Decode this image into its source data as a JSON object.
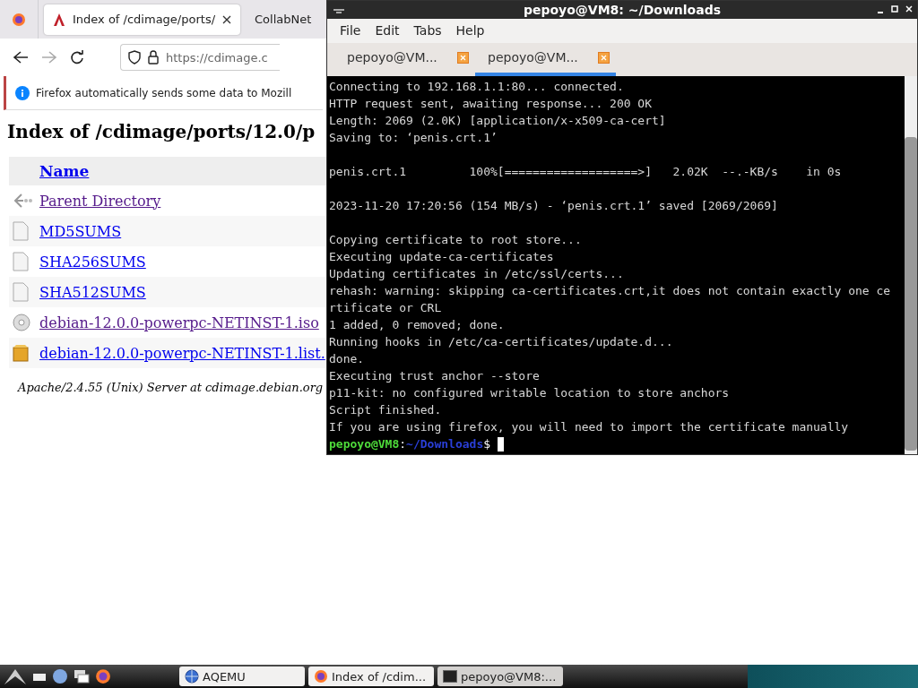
{
  "browser": {
    "tabs": [
      {
        "title": "Index of /cdimage/ports/",
        "selected": true
      },
      {
        "title": "CollabNet",
        "selected": false
      }
    ],
    "url": "https://cdimage.c",
    "notification": "Firefox automatically sends some data to Mozill",
    "heading": "Index of /cdimage/ports/12.0/p",
    "listing": {
      "header": "Name",
      "rows": [
        {
          "kind": "parent",
          "name": "Parent Directory",
          "visited": true
        },
        {
          "kind": "file",
          "name": "MD5SUMS",
          "visited": false
        },
        {
          "kind": "file",
          "name": "SHA256SUMS",
          "visited": false
        },
        {
          "kind": "file",
          "name": "SHA512SUMS",
          "visited": false
        },
        {
          "kind": "disc",
          "name": "debian-12.0.0-powerpc-NETINST-1.iso",
          "visited": true
        },
        {
          "kind": "package",
          "name": "debian-12.0.0-powerpc-NETINST-1.list.",
          "visited": false
        }
      ]
    },
    "footer": "Apache/2.4.55 (Unix) Server at cdimage.debian.org"
  },
  "terminal": {
    "title": "pepoyo@VM8: ~/Downloads",
    "menu": [
      "File",
      "Edit",
      "Tabs",
      "Help"
    ],
    "tabs": [
      {
        "label": "pepoyo@VM...",
        "selected": false
      },
      {
        "label": "pepoyo@VM...",
        "selected": true
      }
    ],
    "lines": [
      {
        "kind": "text",
        "text": "Connecting to 192.168.1.1:80... connected."
      },
      {
        "kind": "text",
        "text": "HTTP request sent, awaiting response... 200 OK"
      },
      {
        "kind": "text",
        "text": "Length: 2069 (2.0K) [application/x-x509-ca-cert]"
      },
      {
        "kind": "text",
        "text": "Saving to: ‘penis.crt.1’"
      },
      {
        "kind": "blank"
      },
      {
        "kind": "text",
        "text": "penis.crt.1         100%[===================>]   2.02K  --.-KB/s    in 0s"
      },
      {
        "kind": "blank"
      },
      {
        "kind": "text",
        "text": "2023-11-20 17:20:56 (154 MB/s) - ‘penis.crt.1’ saved [2069/2069]"
      },
      {
        "kind": "blank"
      },
      {
        "kind": "text",
        "text": "Copying certificate to root store..."
      },
      {
        "kind": "text",
        "text": "Executing update-ca-certificates"
      },
      {
        "kind": "text",
        "text": "Updating certificates in /etc/ssl/certs..."
      },
      {
        "kind": "text",
        "text": "rehash: warning: skipping ca-certificates.crt,it does not contain exactly one ce"
      },
      {
        "kind": "text",
        "text": "rtificate or CRL"
      },
      {
        "kind": "text",
        "text": "1 added, 0 removed; done."
      },
      {
        "kind": "text",
        "text": "Running hooks in /etc/ca-certificates/update.d..."
      },
      {
        "kind": "text",
        "text": "done."
      },
      {
        "kind": "text",
        "text": "Executing trust anchor --store"
      },
      {
        "kind": "text",
        "text": "p11-kit: no configured writable location to store anchors"
      },
      {
        "kind": "text",
        "text": "Script finished."
      },
      {
        "kind": "text",
        "text": "If you are using firefox, you will need to import the certificate manually"
      }
    ],
    "prompt": {
      "user": "pepoyo@VM8",
      "separator": ":",
      "path": "~/Downloads",
      "symbol": "$"
    }
  },
  "taskbar": {
    "tasks": [
      {
        "kind": "qemu",
        "label": "AQEMU",
        "selected": false
      },
      {
        "kind": "firefox",
        "label": "Index of /cdim...",
        "selected": false
      },
      {
        "kind": "terminal",
        "label": "pepoyo@VM8:...",
        "selected": true
      }
    ]
  }
}
